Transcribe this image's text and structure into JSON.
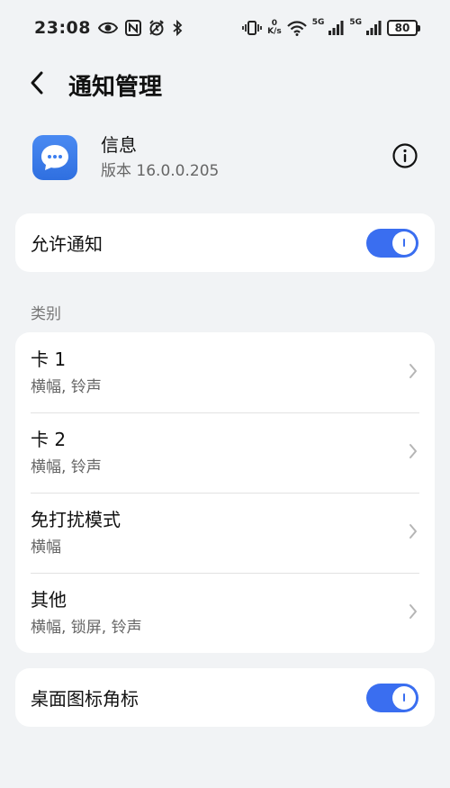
{
  "status_bar": {
    "time": "23:08",
    "net_speed_value": "0",
    "net_speed_unit": "K/s",
    "sim1_label": "5G",
    "sim2_label": "5G",
    "battery": "80",
    "icons": [
      "eye-icon",
      "nfc-icon",
      "alarm-icon",
      "bluetooth-icon",
      "vibrate-icon",
      "wifi-icon",
      "signal-icon",
      "battery-icon"
    ]
  },
  "header": {
    "title": "通知管理",
    "back_icon": "chevron-left-icon"
  },
  "app": {
    "name": "信息",
    "version": "版本 16.0.0.205",
    "icon": "message-bubble-icon",
    "info_icon": "info-icon",
    "brand_color": "#3a7ef0"
  },
  "allow_notifications": {
    "label": "允许通知",
    "enabled": true
  },
  "categories": {
    "section_label": "类别",
    "items": [
      {
        "title": "卡 1",
        "subtitle": "横幅, 铃声"
      },
      {
        "title": "卡 2",
        "subtitle": "横幅, 铃声"
      },
      {
        "title": "免打扰模式",
        "subtitle": "横幅"
      },
      {
        "title": "其他",
        "subtitle": "横幅, 锁屏, 铃声"
      }
    ]
  },
  "badge": {
    "label": "桌面图标角标",
    "enabled": true
  },
  "colors": {
    "accent": "#3a6ef0",
    "background": "#f1f3f5",
    "card": "#ffffff"
  }
}
